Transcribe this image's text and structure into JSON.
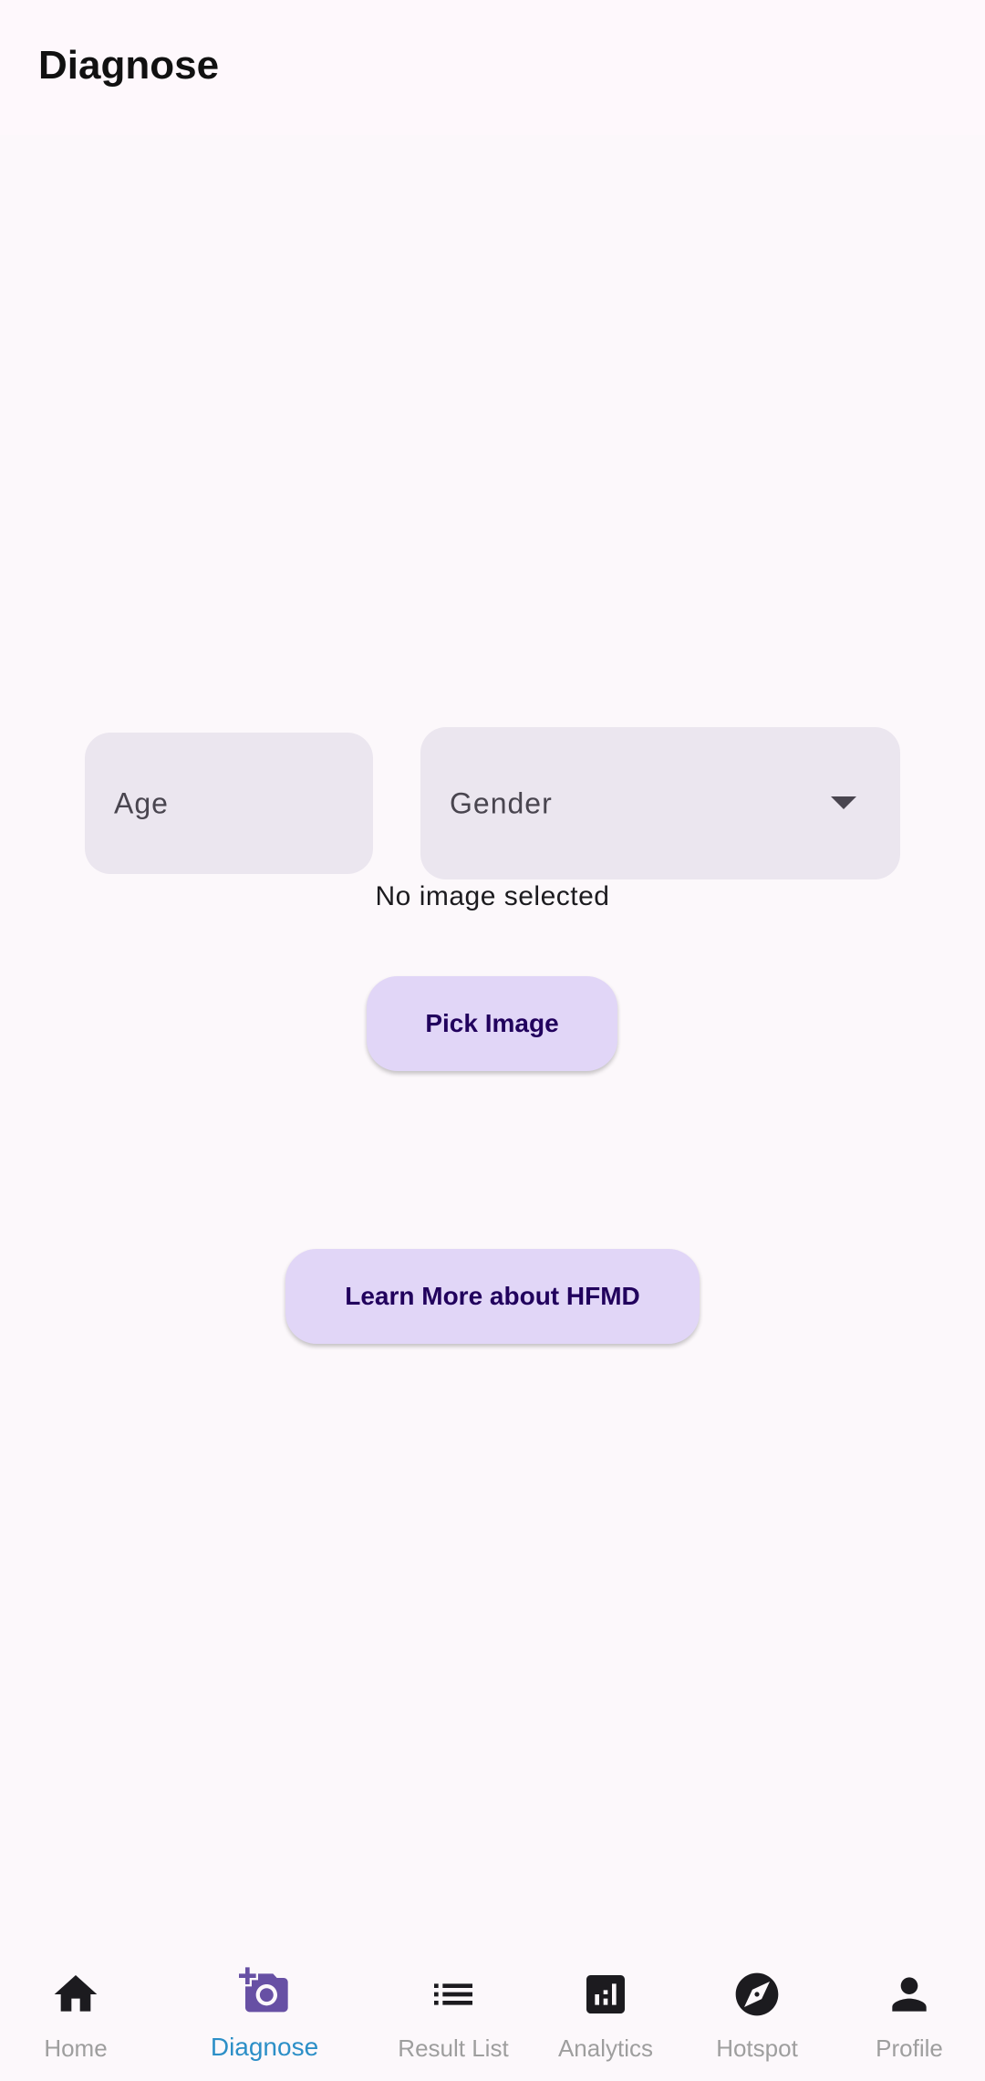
{
  "app_bar": {
    "title": "Diagnose"
  },
  "form": {
    "age_placeholder": "Age",
    "gender_placeholder": "Gender"
  },
  "status": {
    "image_text": "No image selected"
  },
  "buttons": {
    "pick_image": "Pick Image",
    "learn_more": "Learn More about HFMD"
  },
  "bottom_nav": {
    "active": "Diagnose",
    "active_color": "#2c8fc7",
    "items": [
      {
        "label": "Home",
        "icon": "home-icon"
      },
      {
        "label": "Diagnose",
        "icon": "add-a-photo-icon"
      },
      {
        "label": "Result List",
        "icon": "list-icon"
      },
      {
        "label": "Analytics",
        "icon": "analytics-icon"
      },
      {
        "label": "Hotspot",
        "icon": "explore-icon"
      },
      {
        "label": "Profile",
        "icon": "person-icon"
      }
    ]
  },
  "colors": {
    "background": "#fcf8fb",
    "field_fill": "#ebe6ef",
    "button_fill": "#e1d6f7",
    "button_text": "#21005d",
    "accent_icon": "#6750a4"
  }
}
